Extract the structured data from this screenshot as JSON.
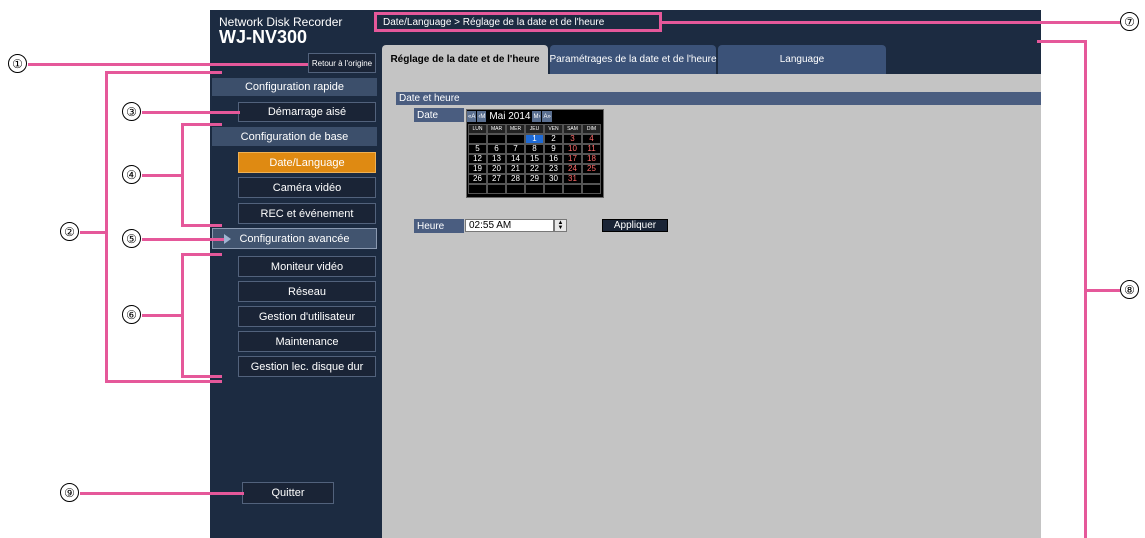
{
  "app": {
    "brand_line1": "Network Disk Recorder",
    "brand_line2": "WJ-NV300"
  },
  "breadcrumb": "Date/Language > Réglage de la date et de l'heure",
  "sidebar": {
    "home_button": "Retour à l'origine",
    "quick_setup": "Configuration rapide",
    "easy_start": "Démarrage aisé",
    "basic_setup": "Configuration de base",
    "basic_items": [
      "Date/Language",
      "Caméra vidéo",
      "REC et événement"
    ],
    "advanced_setup": "Configuration avancée",
    "advanced_items": [
      "Moniteur vidéo",
      "Réseau",
      "Gestion d'utilisateur",
      "Maintenance",
      "Gestion lec. disque dur"
    ],
    "quit_button": "Quitter",
    "active_item": "Date/Language"
  },
  "tabs": [
    {
      "label": "Réglage de la date et de l'heure",
      "active": true
    },
    {
      "label": "Paramétrages de la date et de l'heure",
      "active": false
    },
    {
      "label": "Language",
      "active": false
    }
  ],
  "content": {
    "section_title": "Date et heure",
    "date_label": "Date",
    "time_label": "Heure",
    "time_value": "02:55 AM",
    "apply_button": "Appliquer"
  },
  "calendar": {
    "nav_prev_year": "«A",
    "nav_prev_month": "‹M",
    "month_label": "Mai 2014",
    "nav_next_month": "M›",
    "nav_next_year": "A»",
    "weekdays": [
      "LUN",
      "MAR",
      "MER",
      "JEU",
      "VEN",
      "SAM",
      "DIM"
    ],
    "weeks": [
      [
        "",
        "",
        "",
        "1",
        "2",
        "3",
        "4"
      ],
      [
        "5",
        "6",
        "7",
        "8",
        "9",
        "10",
        "11"
      ],
      [
        "12",
        "13",
        "14",
        "15",
        "16",
        "17",
        "18"
      ],
      [
        "19",
        "20",
        "21",
        "22",
        "23",
        "24",
        "25"
      ],
      [
        "26",
        "27",
        "28",
        "29",
        "30",
        "31",
        ""
      ],
      [
        "",
        "",
        "",
        "",
        "",
        "",
        ""
      ]
    ],
    "selected_day": "1"
  },
  "callouts": [
    "①",
    "②",
    "③",
    "④",
    "⑤",
    "⑥",
    "⑦",
    "⑧",
    "⑨"
  ],
  "colors": {
    "accent_active": "#df8a12",
    "callout_line": "#e5589a",
    "panel_bg": "#1c2b41",
    "content_bg": "#c4c4c4"
  }
}
